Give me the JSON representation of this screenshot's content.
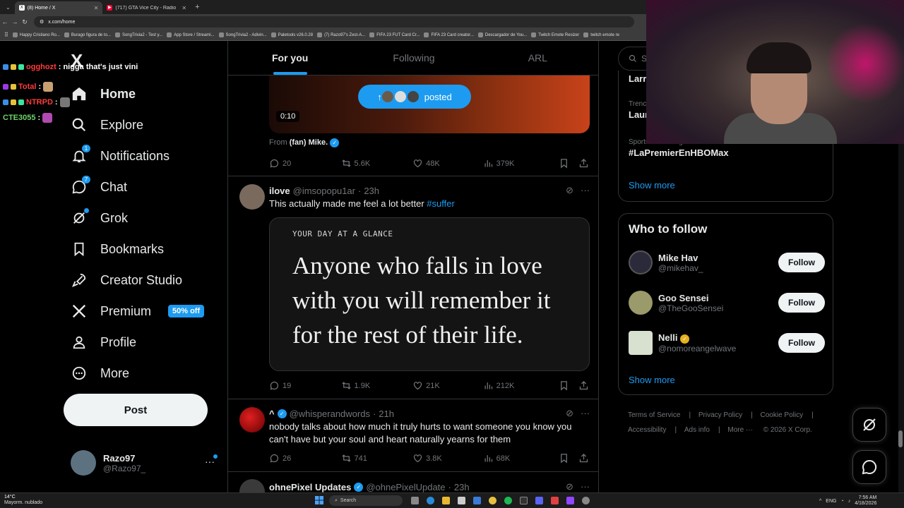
{
  "browser": {
    "tabs": [
      {
        "title": "(8) Home / X",
        "active": true
      },
      {
        "title": "(717) GTA Vice City - Radio",
        "active": false
      }
    ],
    "url": "x.com/home",
    "bookmarks": [
      "Happy Cristiano Ro...",
      "Burago figura de to...",
      "SongTrivia2 - Test y...",
      "App Store / Streami...",
      "SongTrivia2 - Adivin...",
      "Paletools v26.0.28",
      "(7) Razo97's Zest-A...",
      "FIFA 23 FUT Card Cr...",
      "FIFA 23 Card creator...",
      "Descargador de You...",
      "Twitch Emote Resizer",
      "twitch emote re"
    ]
  },
  "sidebar": {
    "logo": "X",
    "items": [
      {
        "label": "Home",
        "icon": "home-icon",
        "active": true
      },
      {
        "label": "Explore",
        "icon": "search-icon"
      },
      {
        "label": "Notifications",
        "icon": "bell-icon",
        "badge": "1"
      },
      {
        "label": "Chat",
        "icon": "chat-icon",
        "badge": "7"
      },
      {
        "label": "Grok",
        "icon": "grok-icon",
        "dot": true
      },
      {
        "label": "Bookmarks",
        "icon": "bookmark-icon"
      },
      {
        "label": "Creator Studio",
        "icon": "rocket-icon"
      },
      {
        "label": "Premium",
        "icon": "x-logo-icon",
        "promo": "50% off"
      },
      {
        "label": "Profile",
        "icon": "person-icon"
      },
      {
        "label": "More",
        "icon": "more-circle-icon"
      }
    ],
    "post_label": "Post",
    "profile": {
      "name": "Razo97",
      "handle": "@Razo97_"
    }
  },
  "chat_overlay": [
    {
      "user": "ogghozt",
      "msg": "nigga that's just vini"
    },
    {
      "user": "Total",
      "msg": ""
    },
    {
      "user": "NTRPD",
      "msg": ""
    },
    {
      "user": "CTE3055",
      "msg": ""
    }
  ],
  "feed": {
    "tabs": [
      "For you",
      "Following",
      "ARL"
    ],
    "posted_pill": "posted",
    "video": {
      "duration": "0:10",
      "from_prefix": "From",
      "from_name": "(fan) Mike."
    },
    "video_stats": {
      "replies": "20",
      "reposts": "5.6K",
      "likes": "48K",
      "views": "379K"
    },
    "tweets": [
      {
        "name": "ilove",
        "handle": "@imsopopu1ar",
        "time": "23h",
        "text": "This actually made me feel a lot better ",
        "hashtag": "#suffer",
        "card_label": "YOUR DAY AT A GLANCE",
        "card_quote": "Anyone who falls in love with you will remember it for the rest of their life.",
        "stats": {
          "replies": "19",
          "reposts": "1.9K",
          "likes": "21K",
          "views": "212K"
        }
      },
      {
        "name": "^",
        "handle": "@whisperandwords",
        "time": "21h",
        "text": "nobody talks about how much it truly hurts to want someone you know you can't have but your soul and heart naturally yearns for them",
        "stats": {
          "replies": "26",
          "reposts": "741",
          "likes": "3.8K",
          "views": "68K"
        }
      },
      {
        "name": "ohnePixel Updates",
        "handle": "@ohnePixelUpdate",
        "time": "23h"
      }
    ]
  },
  "right": {
    "search_placeholder": "Se",
    "trends": [
      {
        "meta": "",
        "title": "Larr"
      },
      {
        "meta": "Trenc",
        "title": "Laur"
      },
      {
        "meta": "Sports · Trending",
        "title": "#LaPremierEnHBOMax"
      }
    ],
    "show_more": "Show more",
    "who_to_follow_title": "Who to follow",
    "who_to_follow": [
      {
        "name": "Mike Hav",
        "handle": "@mikehav_"
      },
      {
        "name": "Goo Sensei",
        "handle": "@TheGooSensei"
      },
      {
        "name": "Nelli",
        "handle": "@nomoreangelwave"
      }
    ],
    "follow_label": "Follow",
    "footer": [
      "Terms of Service",
      "Privacy Policy",
      "Cookie Policy",
      "Accessibility",
      "Ads info",
      "More ···",
      "© 2026 X Corp."
    ]
  },
  "taskbar": {
    "temp": "14°C",
    "weather": "Mayorm. nublado",
    "search": "Search",
    "lang": "ENG",
    "time": "7:56 AM",
    "date": "4/18/2026"
  },
  "colors": {
    "accent": "#1d9bf0",
    "background": "#000000",
    "border": "#2f3336",
    "muted": "#71767b"
  }
}
